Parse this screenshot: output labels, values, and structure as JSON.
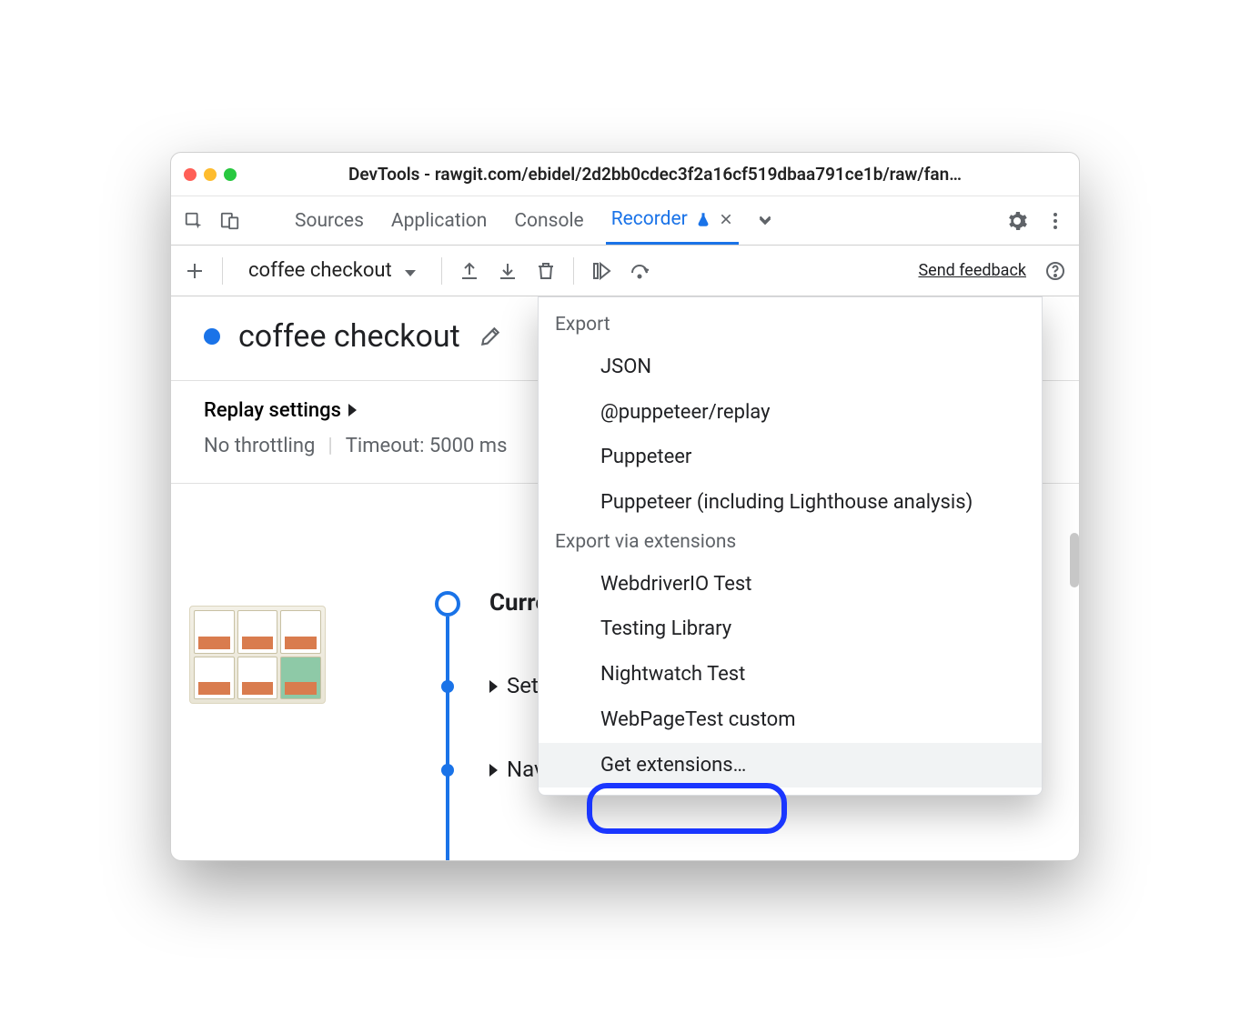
{
  "window": {
    "title": "DevTools - rawgit.com/ebidel/2d2bb0cdec3f2a16cf519dbaa791ce1b/raw/fan…"
  },
  "tabs": {
    "sources": "Sources",
    "application": "Application",
    "console": "Console",
    "recorder": "Recorder"
  },
  "toolbar": {
    "recording_name": "coffee checkout",
    "feedback": "Send feedback"
  },
  "recording": {
    "name": "coffee checkout"
  },
  "replay": {
    "heading": "Replay settings",
    "throttling": "No throttling",
    "timeout": "Timeout: 5000 ms"
  },
  "steps": {
    "current": "Current p",
    "set_viewport": "Set viewp",
    "navigate": "Navigate"
  },
  "dd": {
    "section1": "Export",
    "json": "JSON",
    "replaylib": "@puppeteer/replay",
    "puppeteer": "Puppeteer",
    "puppeteer_lh": "Puppeteer (including Lighthouse analysis)",
    "section2": "Export via extensions",
    "wdio": "WebdriverIO Test",
    "tl": "Testing Library",
    "nw": "Nightwatch Test",
    "wpt": "WebPageTest custom",
    "get": "Get extensions…"
  }
}
